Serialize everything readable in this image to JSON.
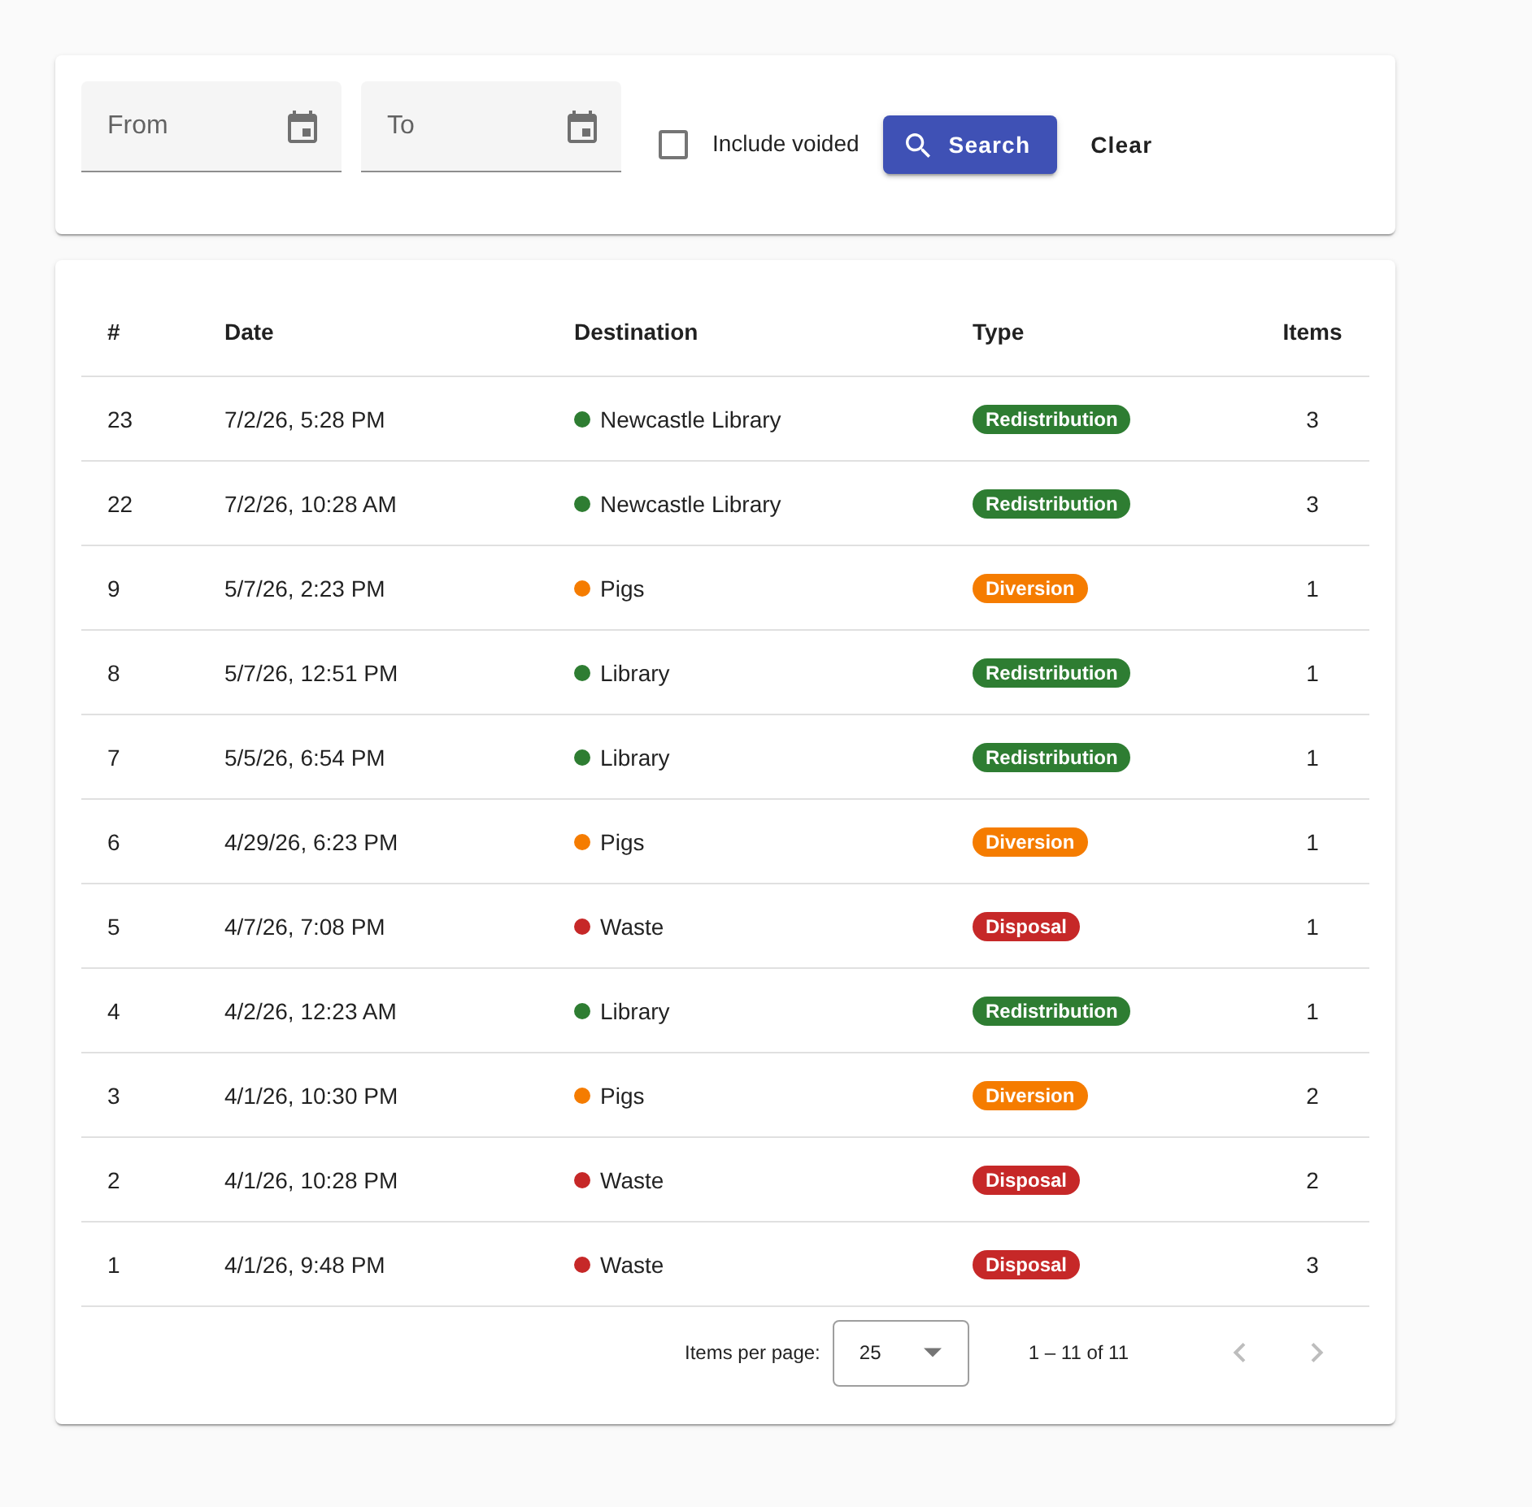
{
  "filters": {
    "date_fields": [
      {
        "placeholder": "From"
      },
      {
        "placeholder": "To"
      }
    ],
    "include_voided": {
      "label": "Include voided",
      "checked": false
    },
    "buttons": [
      {
        "label": "Search",
        "kind": "raised"
      },
      {
        "label": "Clear",
        "kind": "text"
      }
    ]
  },
  "table": {
    "columns": [
      "#",
      "Date",
      "Destination",
      "Type",
      "Items"
    ],
    "rows": [
      {
        "number": "23",
        "date": "7/2/26, 5:28 PM",
        "destination": {
          "name": "Newcastle Library",
          "color": "#2e7d32"
        },
        "type": {
          "label": "Redistribution",
          "color": "#2e7d32"
        },
        "items": "3"
      },
      {
        "number": "22",
        "date": "7/2/26, 10:28 AM",
        "destination": {
          "name": "Newcastle Library",
          "color": "#2e7d32"
        },
        "type": {
          "label": "Redistribution",
          "color": "#2e7d32"
        },
        "items": "3"
      },
      {
        "number": "9",
        "date": "5/7/26, 2:23 PM",
        "destination": {
          "name": "Pigs",
          "color": "#f57c00"
        },
        "type": {
          "label": "Diversion",
          "color": "#f57c00"
        },
        "items": "1"
      },
      {
        "number": "8",
        "date": "5/7/26, 12:51 PM",
        "destination": {
          "name": "Library",
          "color": "#2e7d32"
        },
        "type": {
          "label": "Redistribution",
          "color": "#2e7d32"
        },
        "items": "1"
      },
      {
        "number": "7",
        "date": "5/5/26, 6:54 PM",
        "destination": {
          "name": "Library",
          "color": "#2e7d32"
        },
        "type": {
          "label": "Redistribution",
          "color": "#2e7d32"
        },
        "items": "1"
      },
      {
        "number": "6",
        "date": "4/29/26, 6:23 PM",
        "destination": {
          "name": "Pigs",
          "color": "#f57c00"
        },
        "type": {
          "label": "Diversion",
          "color": "#f57c00"
        },
        "items": "1"
      },
      {
        "number": "5",
        "date": "4/7/26, 7:08 PM",
        "destination": {
          "name": "Waste",
          "color": "#c62828"
        },
        "type": {
          "label": "Disposal",
          "color": "#c62828"
        },
        "items": "1"
      },
      {
        "number": "4",
        "date": "4/2/26, 12:23 AM",
        "destination": {
          "name": "Library",
          "color": "#2e7d32"
        },
        "type": {
          "label": "Redistribution",
          "color": "#2e7d32"
        },
        "items": "1"
      },
      {
        "number": "3",
        "date": "4/1/26, 10:30 PM",
        "destination": {
          "name": "Pigs",
          "color": "#f57c00"
        },
        "type": {
          "label": "Diversion",
          "color": "#f57c00"
        },
        "items": "2"
      },
      {
        "number": "2",
        "date": "4/1/26, 10:28 PM",
        "destination": {
          "name": "Waste",
          "color": "#c62828"
        },
        "type": {
          "label": "Disposal",
          "color": "#c62828"
        },
        "items": "2"
      },
      {
        "number": "1",
        "date": "4/1/26, 9:48 PM",
        "destination": {
          "name": "Waste",
          "color": "#c62828"
        },
        "type": {
          "label": "Disposal",
          "color": "#c62828"
        },
        "items": "3"
      }
    ]
  },
  "paginator": {
    "label": "Items per page:",
    "page_size": "25",
    "range": "1 – 11 of 11",
    "previous": {
      "disabled": true
    },
    "next": {
      "disabled": true
    }
  }
}
